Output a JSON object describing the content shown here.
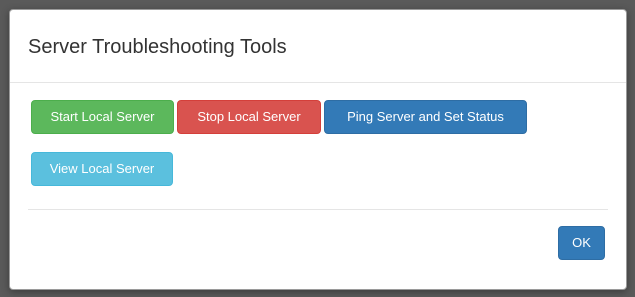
{
  "dialog": {
    "title": "Server Troubleshooting Tools"
  },
  "buttons": {
    "start": "Start Local Server",
    "stop": "Stop Local Server",
    "ping": "Ping Server and Set Status",
    "view": "View Local Server",
    "ok": "OK"
  },
  "colors": {
    "success": "#5cb85c",
    "danger": "#d9534f",
    "primary": "#337ab7",
    "info": "#5bc0de"
  }
}
